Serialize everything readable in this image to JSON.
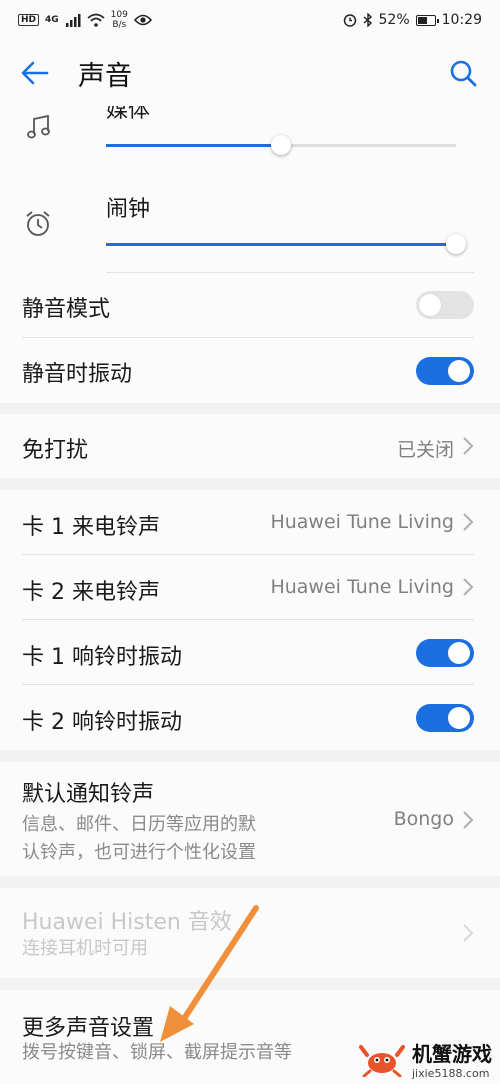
{
  "status_bar": {
    "hd": "HD",
    "network": "4G",
    "speed_top": "109",
    "speed_bottom": "B/s",
    "battery": "52%",
    "time": "10:29"
  },
  "header": {
    "title": "声音"
  },
  "volume": {
    "media_label": "媒体",
    "media_level": 0.5,
    "alarm_label": "闹钟",
    "alarm_level": 1.0
  },
  "toggles1": {
    "silent_mode": "静音模式",
    "silent_mode_on": false,
    "vibrate_on_silent": "静音时振动",
    "vibrate_on_silent_on": true
  },
  "dnd": {
    "label": "免打扰",
    "value": "已关闭"
  },
  "ringtones": {
    "card1_label": "卡 1 来电铃声",
    "card1_value": "Huawei Tune Living",
    "card2_label": "卡 2 来电铃声",
    "card2_value": "Huawei Tune Living",
    "card1_vibrate": "卡 1 响铃时振动",
    "card1_vibrate_on": true,
    "card2_vibrate": "卡 2 响铃时振动",
    "card2_vibrate_on": true
  },
  "notification": {
    "label": "默认通知铃声",
    "desc_line1": "信息、邮件、日历等应用的默",
    "desc_line2": "认铃声，也可进行个性化设置",
    "value": "Bongo"
  },
  "histen": {
    "label": "Huawei Histen 音效",
    "desc": "连接耳机时可用"
  },
  "more": {
    "label": "更多声音设置",
    "desc": "拨号按键音、锁屏、截屏提示音等"
  },
  "watermark": {
    "title": "机蟹游戏",
    "url": "jixie5188.com"
  },
  "colors": {
    "accent": "#1b6fe0",
    "annotation_arrow": "#f0903a"
  }
}
